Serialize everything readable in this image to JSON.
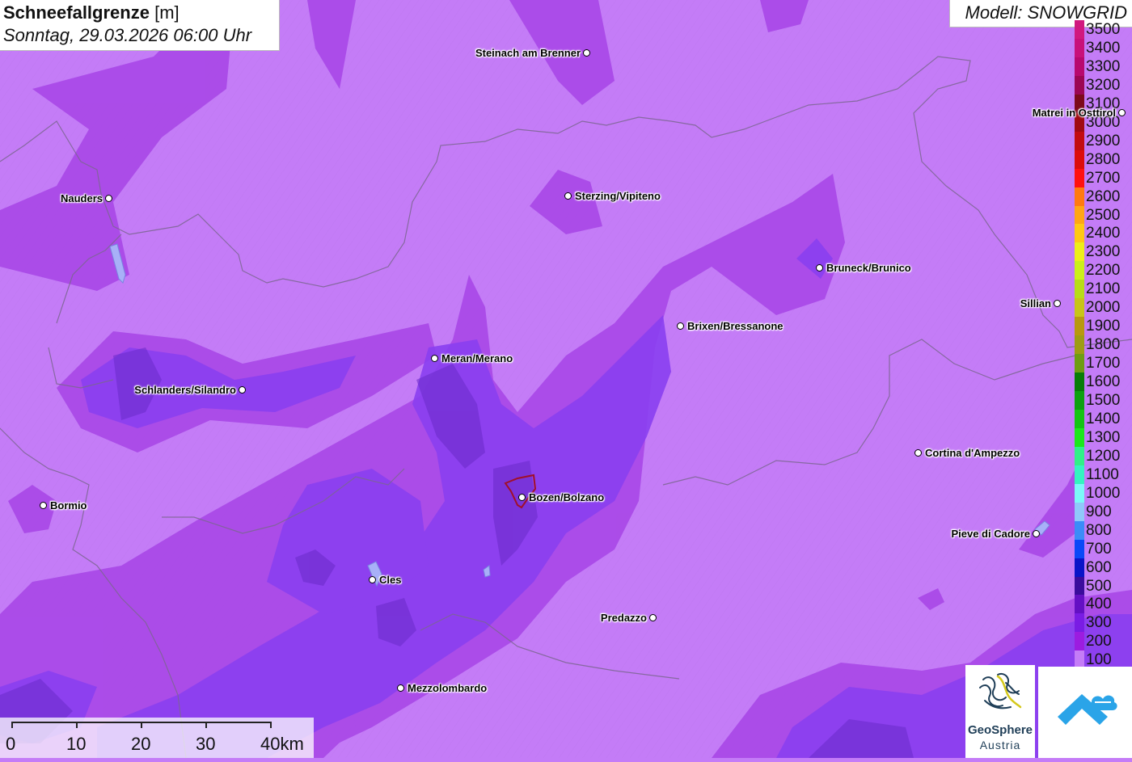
{
  "title": {
    "bold": "Schneefallgrenze",
    "unit": "[m]",
    "datetime": "Sonntag, 29.03.2026 06:00 Uhr"
  },
  "model_label": "Modell: SNOWGRID",
  "legend": [
    {
      "label": "3500",
      "color": "#d1187f"
    },
    {
      "label": "3400",
      "color": "#c8107a"
    },
    {
      "label": "3300",
      "color": "#b8086e"
    },
    {
      "label": "3200",
      "color": "#9c0654"
    },
    {
      "label": "3100",
      "color": "#7c0a1c"
    },
    {
      "label": "3000",
      "color": "#a00a12"
    },
    {
      "label": "2900",
      "color": "#c20c10"
    },
    {
      "label": "2800",
      "color": "#dc0c0c"
    },
    {
      "label": "2700",
      "color": "#ff1010"
    },
    {
      "label": "2600",
      "color": "#ff7a10"
    },
    {
      "label": "2500",
      "color": "#ffa614"
    },
    {
      "label": "2400",
      "color": "#ffc814"
    },
    {
      "label": "2300",
      "color": "#eeee1a"
    },
    {
      "label": "2200",
      "color": "#ccf01c"
    },
    {
      "label": "2100",
      "color": "#b8dc18"
    },
    {
      "label": "2000",
      "color": "#c8c418"
    },
    {
      "label": "1900",
      "color": "#b89810"
    },
    {
      "label": "1800",
      "color": "#9e9c14"
    },
    {
      "label": "1700",
      "color": "#6e9c14"
    },
    {
      "label": "1600",
      "color": "#087c08"
    },
    {
      "label": "1500",
      "color": "#0ea010"
    },
    {
      "label": "1400",
      "color": "#14c414"
    },
    {
      "label": "1300",
      "color": "#1ce81c"
    },
    {
      "label": "1200",
      "color": "#30f088"
    },
    {
      "label": "1100",
      "color": "#34f4c0"
    },
    {
      "label": "1000",
      "color": "#7cf8f8"
    },
    {
      "label": "900",
      "color": "#90c8fa"
    },
    {
      "label": "800",
      "color": "#3c8cf8"
    },
    {
      "label": "700",
      "color": "#0a48f8"
    },
    {
      "label": "600",
      "color": "#0a14c8"
    },
    {
      "label": "500",
      "color": "#3a0c9c"
    },
    {
      "label": "400",
      "color": "#6410c4"
    },
    {
      "label": "300",
      "color": "#7a1ce4"
    },
    {
      "label": "200",
      "color": "#9c1ce0"
    },
    {
      "label": "100",
      "color": "#c47cf7"
    }
  ],
  "cities": [
    {
      "name": "Steinach am Brenner",
      "side": "left"
    },
    {
      "name": "Nauders",
      "side": "left"
    },
    {
      "name": "Sterzing/Vipiteno",
      "side": "right"
    },
    {
      "name": "Bruneck/Brunico",
      "side": "right"
    },
    {
      "name": "Brixen/Bressanone",
      "side": "right"
    },
    {
      "name": "Meran/Merano",
      "side": "right"
    },
    {
      "name": "Schlanders/Silandro",
      "side": "left"
    },
    {
      "name": "Sillian",
      "side": "left"
    },
    {
      "name": "Matrei in Osttirol",
      "side": "left"
    },
    {
      "name": "Cortina d'Ampezzo",
      "side": "right"
    },
    {
      "name": "Bozen/Bolzano",
      "side": "right"
    },
    {
      "name": "Bormio",
      "side": "right"
    },
    {
      "name": "Pieve di Cadore",
      "side": "left"
    },
    {
      "name": "Cles",
      "side": "right"
    },
    {
      "name": "Predazzo",
      "side": "left"
    },
    {
      "name": "Mezzolombardo",
      "side": "right"
    }
  ],
  "scale": {
    "labels": [
      "0",
      "10",
      "20",
      "30",
      "40km"
    ]
  },
  "logo": {
    "name": "GeoSphere",
    "sub": "Austria"
  }
}
